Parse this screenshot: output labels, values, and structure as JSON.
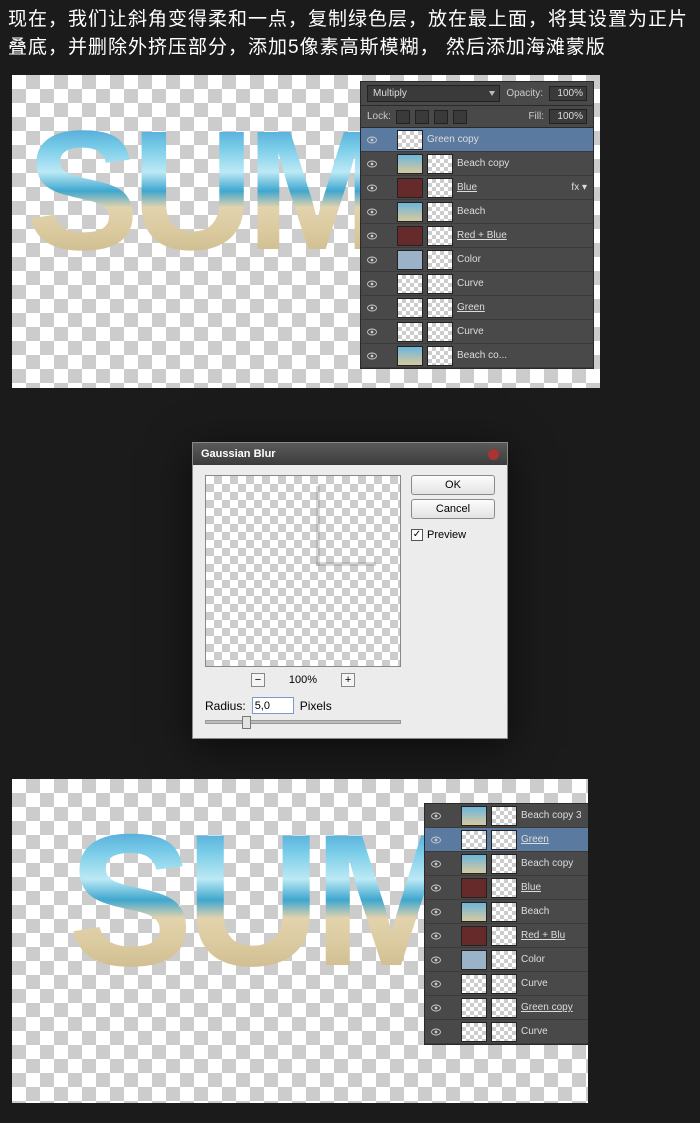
{
  "instruction": "现在，我们让斜角变得柔和一点，复制绿色层，放在最上面，将其设置为正片叠底，并删除外挤压部分，添加5像素高斯模糊， 然后添加海滩蒙版",
  "word": "SUMM",
  "panel1": {
    "blend_mode": "Multiply",
    "opacity_label": "Opacity:",
    "opacity_value": "100%",
    "lock_label": "Lock:",
    "fill_label": "Fill:",
    "fill_value": "100%",
    "layers": [
      {
        "name": "Green copy",
        "sel": true
      },
      {
        "name": "Beach copy"
      },
      {
        "name": "Blue",
        "fx": "fx",
        "u": true,
        "red": true
      },
      {
        "name": "Beach"
      },
      {
        "name": "Red + Blue",
        "u": true,
        "red": true
      },
      {
        "name": "Color"
      },
      {
        "name": "Curve"
      },
      {
        "name": "Green",
        "u": true
      },
      {
        "name": "Curve"
      },
      {
        "name": "Beach co..."
      }
    ]
  },
  "dialog": {
    "title": "Gaussian Blur",
    "ok": "OK",
    "cancel": "Cancel",
    "preview": "Preview",
    "zoom": "100%",
    "radius_label": "Radius:",
    "radius_value": "5,0",
    "radius_unit": "Pixels"
  },
  "panel2": {
    "layers": [
      {
        "name": "Beach copy 3"
      },
      {
        "name": "Green",
        "sel": true,
        "u": true
      },
      {
        "name": "Beach copy"
      },
      {
        "name": "Blue",
        "u": true,
        "red": true
      },
      {
        "name": "Beach"
      },
      {
        "name": "Red + Blu",
        "u": true,
        "red": true
      },
      {
        "name": "Color"
      },
      {
        "name": "Curve"
      },
      {
        "name": "Green copy",
        "u": true
      },
      {
        "name": "Curve"
      }
    ]
  }
}
